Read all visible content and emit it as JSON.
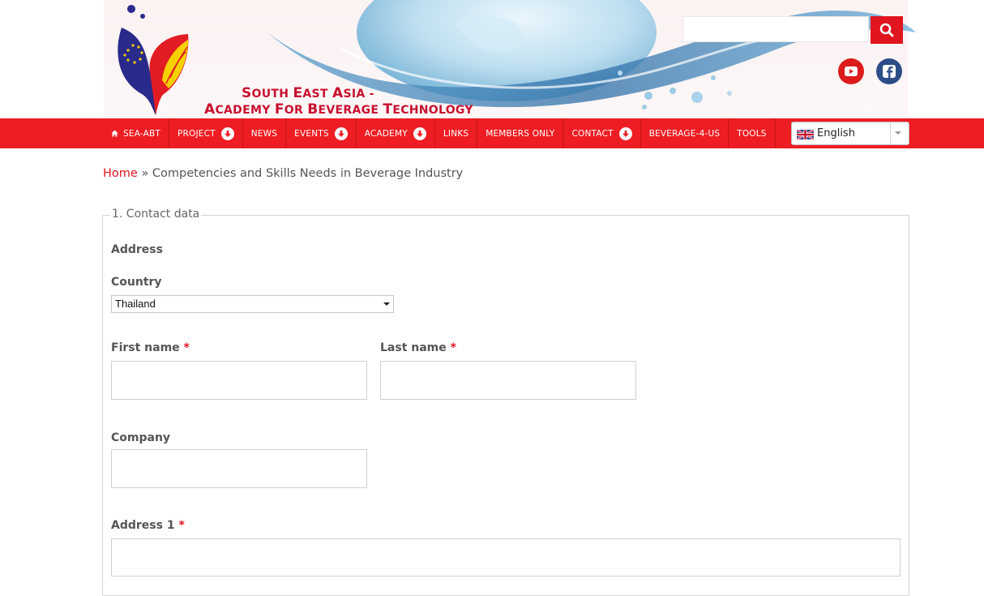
{
  "header": {
    "brand_line1": "South East Asia -",
    "brand_line2": "Academy for Beverage Technology",
    "search": {
      "value": ""
    },
    "icons": {
      "search": "search-icon",
      "youtube": "youtube-icon",
      "facebook": "facebook-icon"
    }
  },
  "nav": {
    "items": [
      {
        "label": "SEA-ABT",
        "icon": "home-icon",
        "has_dropdown": false
      },
      {
        "label": "PROJECT",
        "has_dropdown": true
      },
      {
        "label": "NEWS",
        "has_dropdown": false
      },
      {
        "label": "EVENTS",
        "has_dropdown": true
      },
      {
        "label": "ACADEMY",
        "has_dropdown": true
      },
      {
        "label": "LINKS",
        "has_dropdown": false
      },
      {
        "label": "MEMBERS ONLY",
        "has_dropdown": false
      },
      {
        "label": "CONTACT",
        "has_dropdown": true
      },
      {
        "label": "BEVERAGE-4-US",
        "has_dropdown": false
      },
      {
        "label": "TOOLS",
        "has_dropdown": false
      }
    ],
    "language": "English"
  },
  "breadcrumb": {
    "home": "Home",
    "separator": "»",
    "current": "Competencies and Skills Needs in Beverage Industry"
  },
  "form": {
    "legend": "1. Contact data",
    "address_heading": "Address",
    "country_label": "Country",
    "country_value": "Thailand",
    "first_name_label": "First name",
    "last_name_label": "Last name",
    "company_label": "Company",
    "address1_label": "Address 1",
    "required_mark": "*"
  },
  "colors": {
    "accent": "#ee1d23",
    "link": "#e0151f",
    "brand_text": "#c8102e"
  }
}
